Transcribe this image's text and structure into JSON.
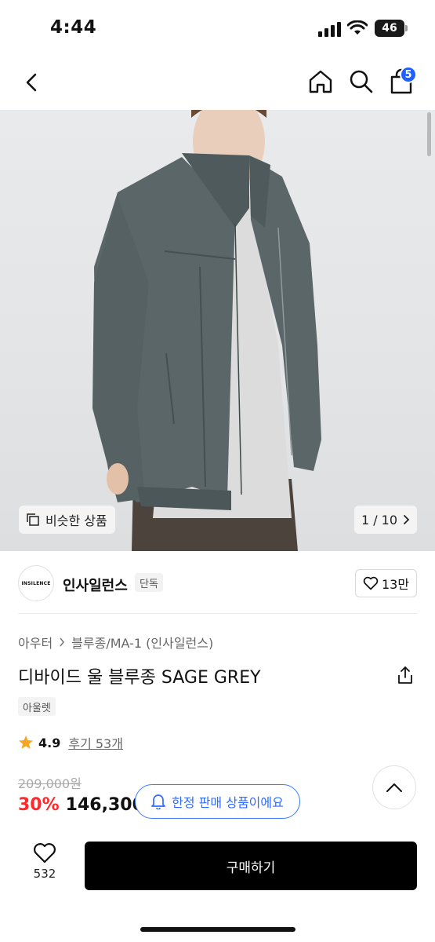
{
  "status_bar": {
    "time": "4:44",
    "battery": "46"
  },
  "nav": {
    "cart_count": "5"
  },
  "hero": {
    "similar_label": "비슷한 상품",
    "page_indicator": "1 / 10"
  },
  "brand": {
    "logo_text": "INSILENCE",
    "name": "인사일런스",
    "tag": "단독",
    "likes": "13만"
  },
  "breadcrumb": [
    "아우터",
    "블루종/MA-1 (인사일런스)"
  ],
  "product": {
    "title": "디바이드 울 블루종 SAGE GREY",
    "tag": "아울렛",
    "rating": "4.9",
    "reviews": "후기 53개",
    "original_price": "209,000원",
    "discount": "30%",
    "price": "146,300"
  },
  "limited_notice": "한정 판매 상품이에요",
  "bottom_bar": {
    "like_count": "532",
    "buy_label": "구매하기"
  },
  "colors": {
    "accent_blue": "#1f5fff",
    "discount_red": "#ff2a2a",
    "star": "#f5a623",
    "buy_button": "#000000"
  }
}
